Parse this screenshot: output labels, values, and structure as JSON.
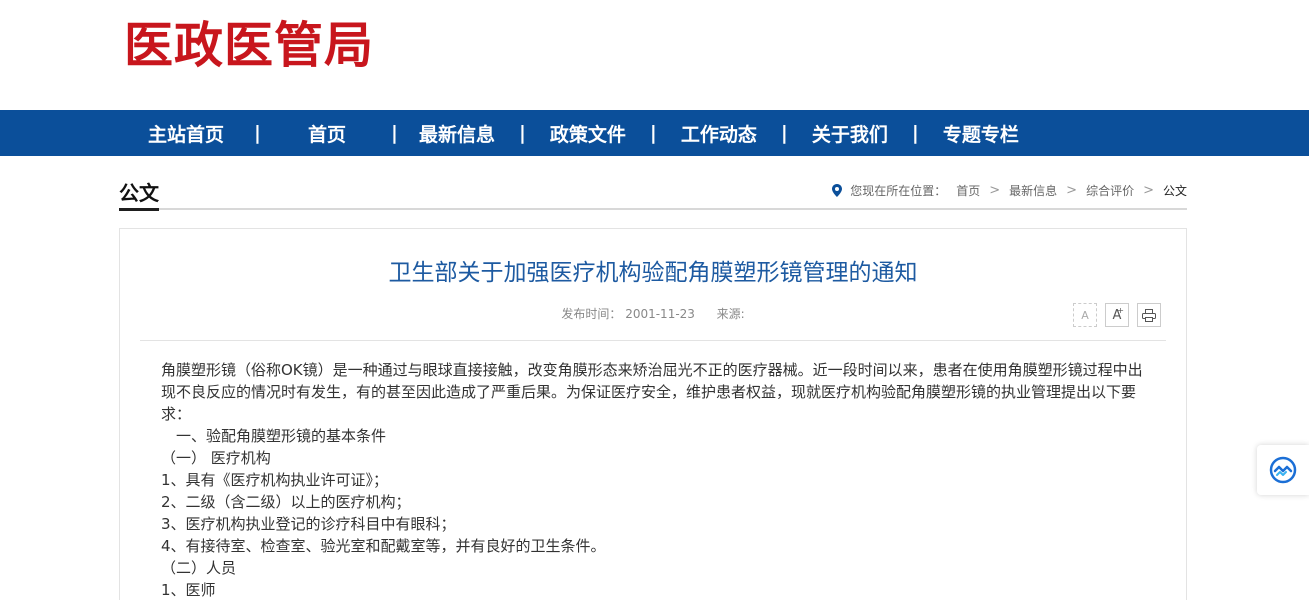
{
  "site": {
    "logo_text": "医政医管局"
  },
  "nav": {
    "items": [
      "主站首页",
      "首页",
      "最新信息",
      "政策文件",
      "工作动态",
      "关于我们",
      "专题专栏"
    ],
    "separator": "|"
  },
  "section": {
    "title": "公文"
  },
  "breadcrumb": {
    "prefix": "您现在所在位置：",
    "items": [
      "首页",
      "最新信息",
      "综合评价"
    ],
    "current": "公文",
    "separator": ">"
  },
  "article": {
    "title": "卫生部关于加强医疗机构验配角膜塑形镜管理的通知",
    "publish_label": "发布时间：",
    "publish_date": "2001-11-23",
    "source_label": "来源:",
    "tools": {
      "font_small": "A",
      "font_large": "A",
      "font_large_sup": "+"
    },
    "paragraphs": [
      "角膜塑形镜（俗称OK镜）是一种通过与眼球直接接触，改变角膜形态来矫治屈光不正的医疗器械。近一段时间以来，患者在使用角膜塑形镜过程中出现不良反应的情况时有发生，有的甚至因此造成了严重后果。为保证医疗安全，维护患者权益，现就医疗机构验配角膜塑形镜的执业管理提出以下要求：",
      "　一、验配角膜塑形镜的基本条件",
      "（一） 医疗机构",
      "1、具有《医疗机构执业许可证》；",
      "2、二级（含二级）以上的医疗机构；",
      "3、医疗机构执业登记的诊疗科目中有眼科；",
      "4、有接待室、检查室、验光室和配戴室等，并有良好的卫生条件。",
      "（二）人员",
      "1、医师"
    ]
  },
  "colors": {
    "brand_red": "#c8161d",
    "nav_blue": "#0b4f9a",
    "title_blue": "#1d5aa1"
  },
  "icons": [
    "location-pin-icon",
    "font-decrease-icon",
    "font-increase-icon",
    "print-icon",
    "floating-assistant-icon"
  ]
}
